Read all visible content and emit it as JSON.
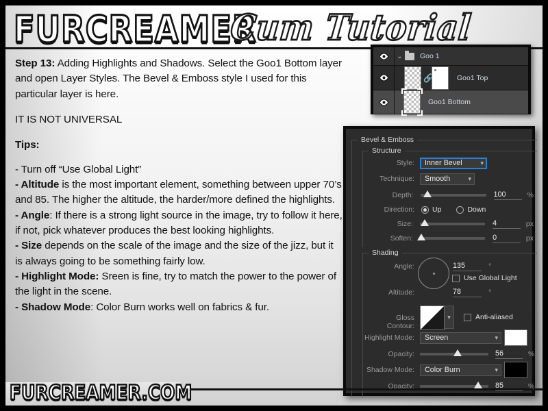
{
  "header": {
    "brand": "FURCREAMER",
    "title": "Cum Tutorial"
  },
  "footer": {
    "site": "FURCREAMER.COM"
  },
  "tutorial": {
    "step_label": "Step 13:",
    "step_text": " Adding Highlights and Shadows. Select the Goo1 Bottom layer and open Layer Styles. The Bevel & Emboss style I used for this particular layer is here.",
    "notice": "IT IS NOT UNIVERSAL",
    "tips_heading": "Tips:",
    "tips": [
      {
        "bold": "",
        "text": "- Turn off “Use Global Light”"
      },
      {
        "bold": "- Altitude",
        "text": " is the most important element, something between upper 70’s and 85. The higher the altitude, the harder/more defined the highlights."
      },
      {
        "bold": "- Angle",
        "text": ": If there is a strong light source in the image, try to follow it here, if not, pick whatever produces the best looking highlights."
      },
      {
        "bold": "- Size",
        "text": " depends on the scale of the image and the size of the jizz, but it is always going to be something fairly low."
      },
      {
        "bold": "- Highlight Mode:",
        "text": " Sreen is fine, try to match the power to the power of the light in the scene."
      },
      {
        "bold": "- Shadow Mode",
        "text": ": Color Burn works well on fabrics & fur."
      }
    ]
  },
  "layers_panel": {
    "rows": [
      {
        "name": "Goo 1",
        "type": "group",
        "visible": true
      },
      {
        "name": "Goo1 Top",
        "type": "layer",
        "visible": true,
        "linked": true
      },
      {
        "name": "Goo1 Bottom",
        "type": "layer",
        "visible": true,
        "selected": true
      }
    ]
  },
  "dialog": {
    "title": "Bevel & Emboss",
    "structure": {
      "legend": "Structure",
      "style_label": "Style:",
      "style_value": "Inner Bevel",
      "technique_label": "Technique:",
      "technique_value": "Smooth",
      "depth_label": "Depth:",
      "depth_value": "100",
      "depth_unit": "%",
      "direction_label": "Direction:",
      "direction_up": "Up",
      "direction_down": "Down",
      "direction_selected": "Up",
      "size_label": "Size:",
      "size_value": "4",
      "size_unit": "px",
      "soften_label": "Soften:",
      "soften_value": "0",
      "soften_unit": "px"
    },
    "shading": {
      "legend": "Shading",
      "angle_label": "Angle:",
      "angle_value": "135",
      "angle_unit": "°",
      "use_global_light_label": "Use Global Light",
      "use_global_light_checked": false,
      "altitude_label": "Altitude:",
      "altitude_value": "78",
      "altitude_unit": "°",
      "gloss_contour_label": "Gloss Contour:",
      "anti_aliased_label": "Anti-aliased",
      "anti_aliased_checked": false,
      "highlight_mode_label": "Highlight Mode:",
      "highlight_mode_value": "Screen",
      "highlight_color": "#ffffff",
      "highlight_opacity_label": "Opacity:",
      "highlight_opacity_value": "56",
      "highlight_opacity_unit": "%",
      "shadow_mode_label": "Shadow Mode:",
      "shadow_mode_value": "Color Burn",
      "shadow_color": "#000000",
      "shadow_opacity_label": "Opacity:",
      "shadow_opacity_value": "85",
      "shadow_opacity_unit": "%"
    }
  }
}
